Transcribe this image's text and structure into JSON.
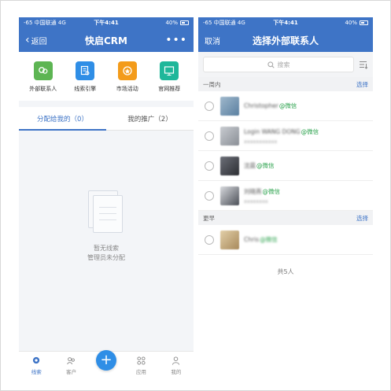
{
  "left": {
    "status": {
      "carrier": "-65 中国联通  4G",
      "time": "下午4:41",
      "battery": "40%"
    },
    "nav": {
      "back_label": "返回",
      "title": "快启CRM",
      "more": "•••"
    },
    "tools": [
      {
        "label": "外部联系人",
        "icon": "contacts-icon",
        "color": "#5db553"
      },
      {
        "label": "线索引擎",
        "icon": "lead-engine-icon",
        "color": "#2f8ee6"
      },
      {
        "label": "市场活动",
        "icon": "campaign-icon",
        "color": "#f39b1a"
      },
      {
        "label": "官网推荐",
        "icon": "website-icon",
        "color": "#1fb79a"
      }
    ],
    "tabs": [
      {
        "label": "分配给我的（0）"
      },
      {
        "label": "我的推广（2）"
      }
    ],
    "empty": {
      "line1": "暂无线索",
      "line2": "管理员未分配"
    },
    "tabbar": [
      {
        "label": "线索",
        "icon": "leads-icon"
      },
      {
        "label": "客户",
        "icon": "customers-icon"
      },
      {
        "label": "+",
        "icon": "plus-icon"
      },
      {
        "label": "应用",
        "icon": "apps-icon"
      },
      {
        "label": "我的",
        "icon": "profile-icon"
      }
    ]
  },
  "right": {
    "status": {
      "carrier": "-65 中国联通  4G",
      "time": "下午4:41",
      "battery": "40%"
    },
    "nav": {
      "cancel_label": "取消",
      "title": "选择外部联系人"
    },
    "search": {
      "placeholder": "搜索"
    },
    "sections": [
      {
        "title": "一周内",
        "select_label": "选择",
        "contacts": [
          {
            "name": "Christopher",
            "wechat": "@微信",
            "sub": "",
            "avatar_color": "#5a7fa0"
          },
          {
            "name": "Login WANG DONG",
            "wechat": "@微信",
            "sub": "xxxxxxxxxxx",
            "avatar_color": "#8a8f96"
          },
          {
            "name": "沈晨",
            "wechat": "@微信",
            "sub": "",
            "avatar_color": "#3d3f45"
          },
          {
            "name": "刘晓燕",
            "wechat": "@微信",
            "sub": "xxxxxxxx",
            "avatar_color": "#6b6f78"
          }
        ]
      },
      {
        "title": "更早",
        "select_label": "选择",
        "contacts": [
          {
            "name": "Chris",
            "wechat": "@微信",
            "sub": "",
            "avatar_color": "#c4a77a"
          }
        ]
      }
    ],
    "total": "共5人"
  },
  "colors": {
    "brand": "#3e74c6",
    "wechat": "#2ea34f",
    "fab": "#2f8ee6"
  }
}
